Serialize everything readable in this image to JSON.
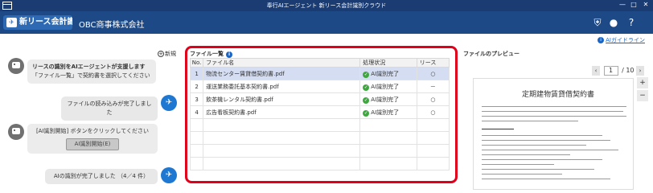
{
  "window": {
    "title": "奉行AIエージェント 新リース会計識別クラウド",
    "minimize": "—",
    "maximize": "□",
    "close": "✕"
  },
  "app": {
    "logo_text": "新リース会計識別",
    "company": "OBC商事株式会社",
    "guide_link": "AIガイドライン"
  },
  "chat": {
    "new_label": "新規",
    "messages": [
      {
        "role": "ai",
        "line1": "リースの識別をAIエージェントが支援します",
        "line2": "「ファイル一覧」で契約書を選択してください"
      },
      {
        "role": "user",
        "text": "ファイルの読み込みが完了しました"
      },
      {
        "role": "ai",
        "line1": "[AI識別開始] ボタンをクリックしてください",
        "button": "AI識別開始(E)"
      },
      {
        "role": "user",
        "text": "AIの識別が完了しました （4／4 件）"
      }
    ]
  },
  "file_list": {
    "title": "ファイル一覧",
    "columns": [
      "No.",
      "ファイル名",
      "処理状況",
      "リース"
    ],
    "rows": [
      {
        "no": "1",
        "name": "物流センター賃貸借契約書.pdf",
        "status": "AI識別完了",
        "lease": "○"
      },
      {
        "no": "2",
        "name": "運送業務委託基本契約書.pdf",
        "status": "AI識別完了",
        "lease": "－"
      },
      {
        "no": "3",
        "name": "飲茶機レンタル契約書.pdf",
        "status": "AI識別完了",
        "lease": "○"
      },
      {
        "no": "4",
        "name": "広告看板契約書.pdf",
        "status": "AI識別完了",
        "lease": "○"
      }
    ]
  },
  "preview": {
    "title": "ファイルのプレビュー",
    "page_current": "1",
    "page_total": "/ 10",
    "doc_title": "定期建物賃貸借契約書"
  }
}
